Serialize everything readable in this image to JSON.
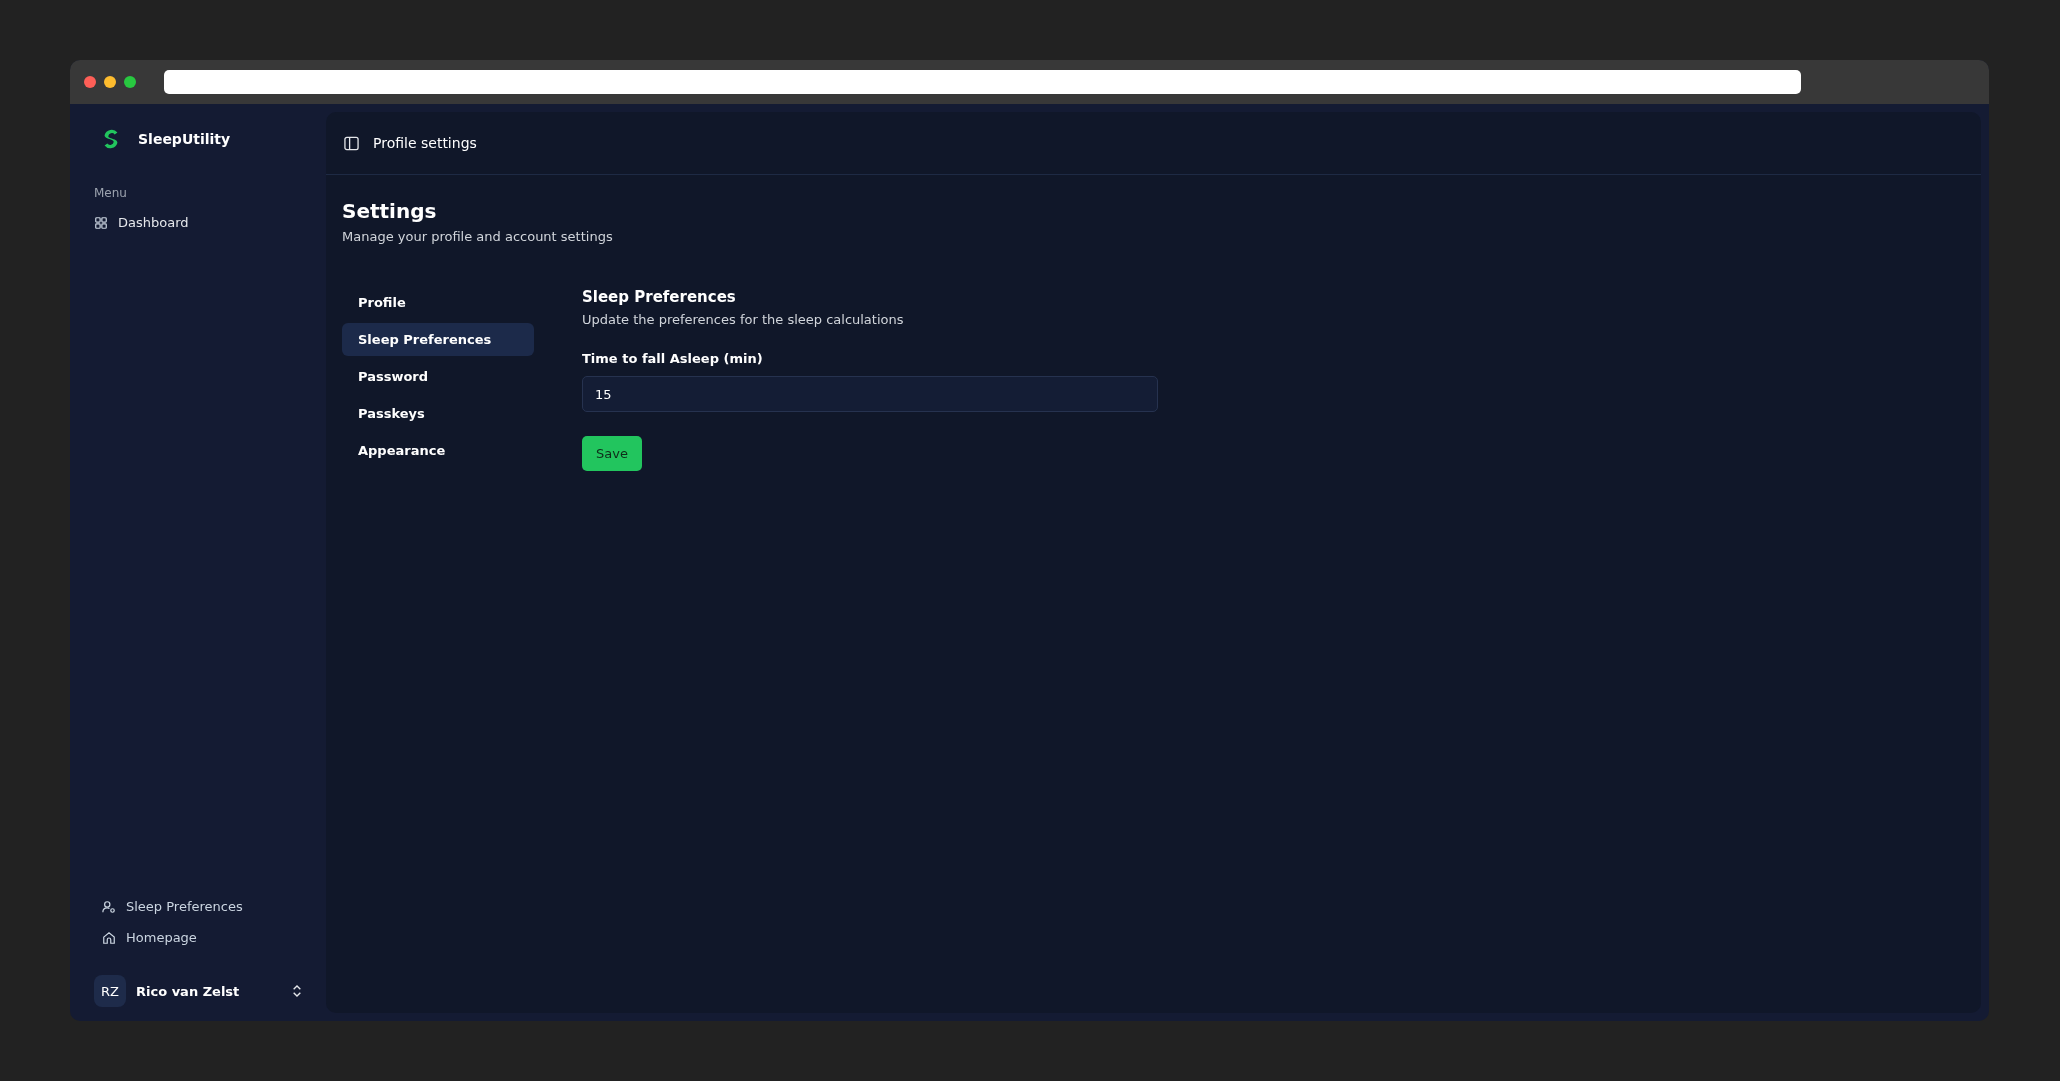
{
  "app": {
    "name": "SleepUtility"
  },
  "sidebar": {
    "section_label": "Menu",
    "items": [
      {
        "label": "Dashboard",
        "kind": "grid"
      }
    ],
    "footer_items": [
      {
        "label": "Sleep Preferences",
        "kind": "user-gear"
      },
      {
        "label": "Homepage",
        "kind": "home"
      }
    ],
    "user": {
      "initials": "RZ",
      "name": "Rico van Zelst"
    }
  },
  "header": {
    "title": "Profile settings"
  },
  "page": {
    "title": "Settings",
    "subtitle": "Manage your profile and account settings"
  },
  "settings_nav": [
    {
      "label": "Profile",
      "selected": false
    },
    {
      "label": "Sleep Preferences",
      "selected": true
    },
    {
      "label": "Password",
      "selected": false
    },
    {
      "label": "Passkeys",
      "selected": false
    },
    {
      "label": "Appearance",
      "selected": false
    }
  ],
  "section": {
    "title": "Sleep Preferences",
    "description": "Update the preferences for the sleep calculations",
    "field_label": "Time to fall Asleep (min)",
    "field_value": "15",
    "button": "Save"
  }
}
